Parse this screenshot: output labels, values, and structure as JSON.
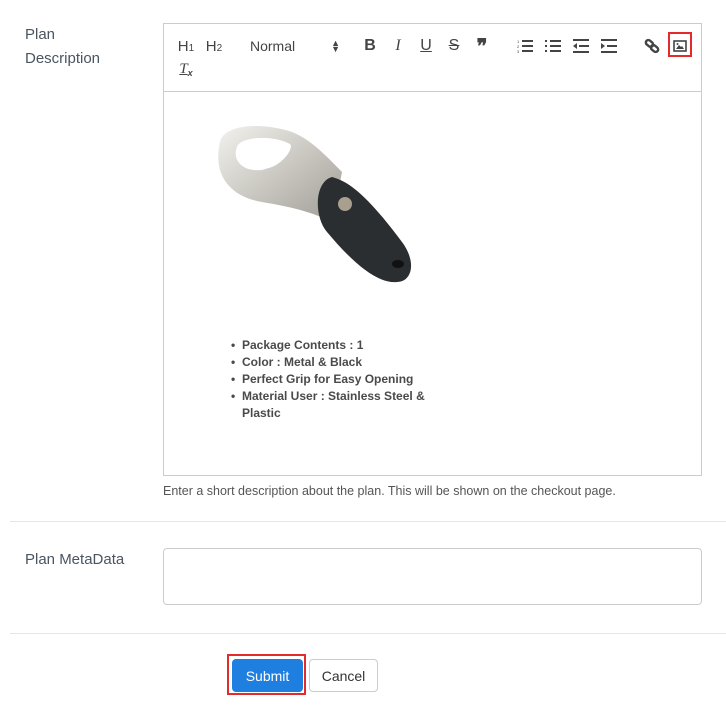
{
  "form": {
    "description_label": "Plan Description",
    "description_label_line1": "Plan",
    "description_label_line2": "Description",
    "description_help": "Enter a short description about the plan. This will be shown on the checkout page.",
    "metadata_label": "Plan MetaData",
    "metadata_value": ""
  },
  "toolbar": {
    "h1": "H1",
    "h2": "H2",
    "format_select": "Normal",
    "bold": "B",
    "italic": "I",
    "underline": "U",
    "strike": "S",
    "quote": "❞",
    "icons": [
      "h1-icon",
      "h2-icon",
      "format-select",
      "bold-icon",
      "italic-icon",
      "underline-icon",
      "strike-icon",
      "blockquote-icon",
      "ordered-list-icon",
      "bullet-list-icon",
      "outdent-icon",
      "indent-icon",
      "link-icon",
      "image-icon",
      "clear-format-icon"
    ],
    "highlighted": "image-icon",
    "highlight_color": "#e32b2b"
  },
  "editor_content": {
    "image_alt": "Bottle opener - metal and black",
    "bullets": [
      "Package Contents : 1",
      "Color : Metal & Black",
      "Perfect Grip for Easy Opening",
      "Material User : Stainless Steel & Plastic"
    ]
  },
  "actions": {
    "submit": "Submit",
    "cancel": "Cancel",
    "primary_color": "#1f7fe0"
  }
}
